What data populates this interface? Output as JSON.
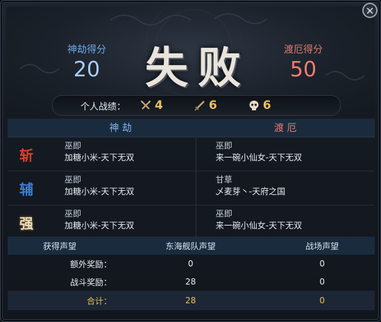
{
  "header": {
    "left_label": "神劫得分",
    "left_score": "20",
    "result": "失败",
    "right_label": "渡厄得分",
    "right_score": "50"
  },
  "personal": {
    "label": "个人战绩：",
    "stats": [
      {
        "icon": "crossed-swords-icon",
        "value": "4"
      },
      {
        "icon": "sword-icon",
        "value": "6"
      },
      {
        "icon": "skull-icon",
        "value": "6"
      }
    ]
  },
  "teams": {
    "left": "神 劫",
    "right": "渡 厄"
  },
  "rows": [
    {
      "badge": "斩",
      "badge_color": "#d9432f",
      "left": {
        "rank": "巫即",
        "name": "加糖小米-天下无双"
      },
      "right": {
        "rank": "巫即",
        "name": "来一碗小仙女-天下无双"
      }
    },
    {
      "badge": "辅",
      "badge_color": "#3b7fd6",
      "left": {
        "rank": "巫即",
        "name": "加糖小米-天下无双"
      },
      "right": {
        "rank": "甘草",
        "name": "乄麦芽丶-天府之国"
      }
    },
    {
      "badge": "强",
      "badge_color": "#e8dcc4",
      "left": {
        "rank": "巫即",
        "name": "加糖小米-天下无双"
      },
      "right": {
        "rank": "巫即",
        "name": "来一碗小仙女-天下无双"
      }
    }
  ],
  "rewards": {
    "headers": [
      "获得声望",
      "东海舰队声望",
      "战场声望"
    ],
    "rows": [
      {
        "label": "额外奖励：",
        "a": "0",
        "b": "0"
      },
      {
        "label": "战斗奖励：",
        "a": "28",
        "b": "0"
      }
    ],
    "total": {
      "label": "合计：",
      "a": "28",
      "b": "0"
    }
  },
  "colors": {
    "gold": "#e8c25a",
    "blue": "#7fb4ec",
    "red": "#e77c70"
  }
}
